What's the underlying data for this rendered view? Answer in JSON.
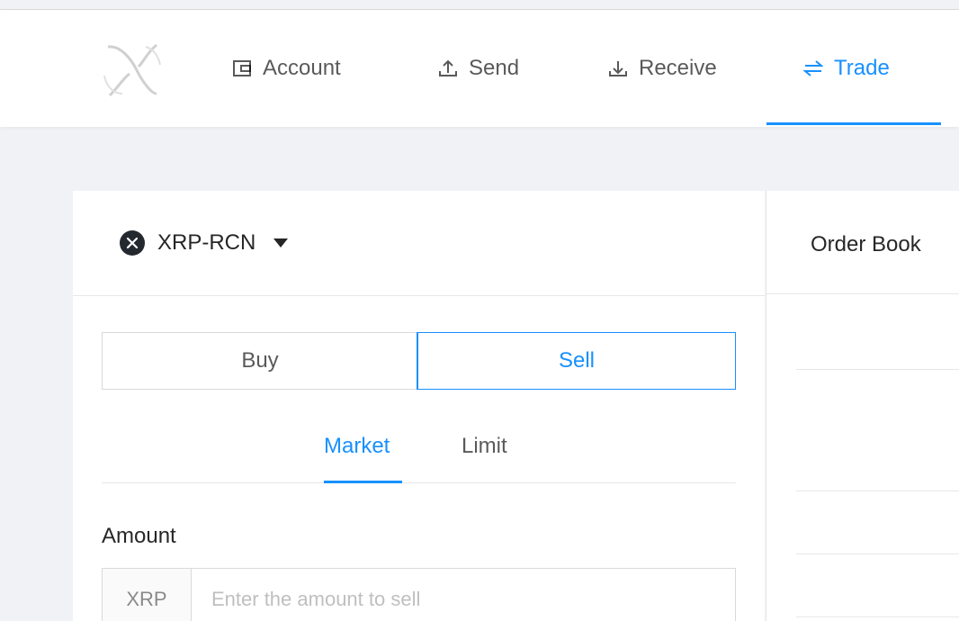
{
  "nav": {
    "items": [
      {
        "label": "Account",
        "icon": "wallet-icon"
      },
      {
        "label": "Send",
        "icon": "upload-icon"
      },
      {
        "label": "Receive",
        "icon": "download-icon"
      },
      {
        "label": "Trade",
        "icon": "swap-icon"
      }
    ],
    "active": "Trade"
  },
  "trade": {
    "pair": "XRP-RCN",
    "side_buy": "Buy",
    "side_sell": "Sell",
    "selected_side": "Sell",
    "tab_market": "Market",
    "tab_limit": "Limit",
    "selected_tab": "Market",
    "amount_label": "Amount",
    "amount_currency": "XRP",
    "amount_placeholder": "Enter the amount to sell",
    "amount_value": ""
  },
  "order_book": {
    "title": "Order Book"
  },
  "colors": {
    "accent": "#1890ff",
    "background": "#f0f2f5",
    "border": "#d9d9d9",
    "coin": "#23292f"
  }
}
